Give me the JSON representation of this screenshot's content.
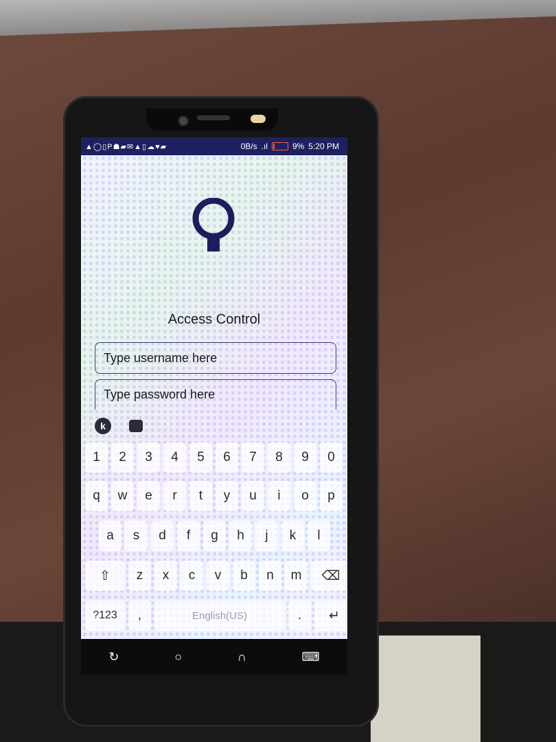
{
  "status_bar": {
    "left_icons": "▲◯▯P☗▰✉▲▯☁♥▰",
    "speed": "0B/s",
    "battery_percent": "9%",
    "time": "5:20 PM"
  },
  "app": {
    "title": "Access Control",
    "username_placeholder": "Type username here",
    "password_placeholder": "Type password here"
  },
  "keyboard": {
    "toolbar": [
      "k"
    ],
    "row1": [
      "1",
      "2",
      "3",
      "4",
      "5",
      "6",
      "7",
      "8",
      "9",
      "0"
    ],
    "row2": [
      "q",
      "w",
      "e",
      "r",
      "t",
      "y",
      "u",
      "i",
      "o",
      "p"
    ],
    "row3": [
      "a",
      "s",
      "d",
      "f",
      "g",
      "h",
      "j",
      "k",
      "l"
    ],
    "row4_letters": [
      "z",
      "x",
      "c",
      "v",
      "b",
      "n",
      "m"
    ],
    "symbols_label": "?123",
    "comma": ",",
    "space_label": "English(US)",
    "period": "."
  },
  "icons": {
    "logo": "lock-keyhole-icon",
    "shift": "shift-icon",
    "backspace": "backspace-icon",
    "enter": "enter-icon",
    "nav_back": "back-icon",
    "nav_home": "home-icon",
    "nav_recents": "recents-icon",
    "nav_keyboard": "keyboard-icon"
  },
  "colors": {
    "accent": "#1e2160",
    "status_bar_bg": "#1e2160"
  }
}
